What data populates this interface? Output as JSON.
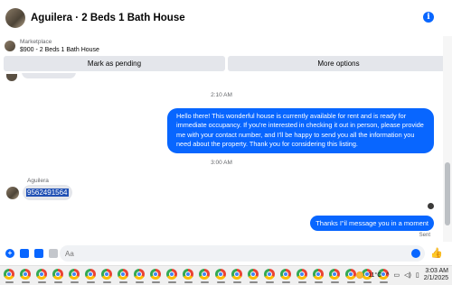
{
  "header": {
    "title": "Aguilera · 2 Beds 1 Bath House",
    "info_icon": "i"
  },
  "listing": {
    "marketplace_label": "Marketplace",
    "price_title": "$900 - 2 Beds 1 Bath House"
  },
  "actions": {
    "mark_pending": "Mark as pending",
    "more_options": "More options"
  },
  "thread": {
    "timestamp_1": "2:10 AM",
    "outgoing_message_1": "Hello there! This wonderful house is currently available for rent and is ready for immediate occupancy. If you're interested in checking it out in person, please provide me with your contact number, and I'll be happy to send you all the information you need about the property. Thank you for considering this listing.",
    "timestamp_2": "3:00 AM",
    "sender_name": "Aguilera",
    "incoming_message": "9562491564",
    "outgoing_message_2": "Thanks I\"il message you in a moment",
    "sent_status": "Sent"
  },
  "composer": {
    "placeholder": "Aa",
    "plus_icon": "+",
    "like_icon": "👍"
  },
  "taskbar": {
    "temperature": "11°C",
    "time": "3:03 AM",
    "date": "2/1/2025",
    "tray_chevron": "^",
    "app_icon_count": 24
  },
  "colors": {
    "accent": "#0866ff",
    "bubble_in": "#e4e6eb",
    "muted_text": "#65676b"
  }
}
